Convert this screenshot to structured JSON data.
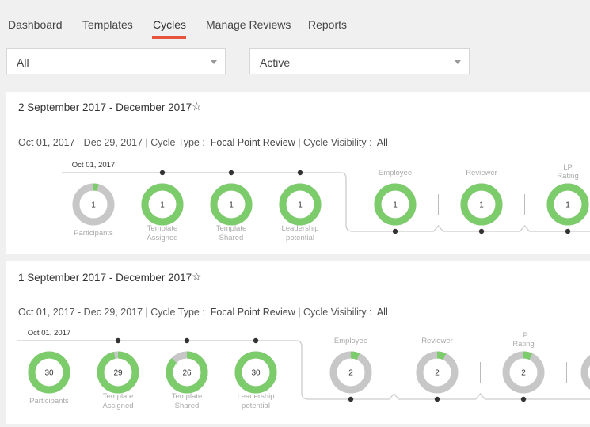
{
  "nav": {
    "tabs": [
      {
        "label": "Dashboard"
      },
      {
        "label": "Templates"
      },
      {
        "label": "Cycles"
      },
      {
        "label": "Manage Reviews"
      },
      {
        "label": "Reports"
      }
    ]
  },
  "filters": {
    "first": "All",
    "second": "Active"
  },
  "colors": {
    "green": "#7ccc6c",
    "grey": "#c7c7c7",
    "accent": "#e8553e"
  },
  "cycles": [
    {
      "title": "2 September 2017 - December 2017",
      "dates": "Oct 01, 2017 - Dec 29, 2017",
      "cycle_type_label": "Cycle Type :",
      "cycle_type": "Focal Point Review",
      "visibility_label": "Cycle Visibility :",
      "visibility": "All",
      "start_label": "Oct 01, 2017",
      "steps": [
        {
          "value": "1",
          "label1": "Participants",
          "label2": "",
          "fraction": 0.04
        },
        {
          "value": "1",
          "label1": "Template",
          "label2": "Assigned",
          "fraction": 1
        },
        {
          "value": "1",
          "label1": "Template",
          "label2": "Shared",
          "fraction": 1
        },
        {
          "value": "1",
          "label1": "Leadership",
          "label2": "potential",
          "fraction": 1
        }
      ],
      "reviews": [
        {
          "value": "1",
          "label1": "Employee",
          "label2": "",
          "fraction": 1
        },
        {
          "value": "1",
          "label1": "Reviewer",
          "label2": "",
          "fraction": 1
        },
        {
          "value": "1",
          "label1": "LP",
          "label2": "Rating",
          "fraction": 1
        }
      ]
    },
    {
      "title": "1 September 2017 - December 2017",
      "dates": "Oct 01, 2017 - Dec 29, 2017",
      "cycle_type_label": "Cycle Type :",
      "cycle_type": "Focal Point Review",
      "visibility_label": "Cycle Visibility :",
      "visibility": "All",
      "start_label": "Oct 01, 2017",
      "steps": [
        {
          "value": "30",
          "label1": "Participants",
          "label2": "",
          "fraction": 1
        },
        {
          "value": "29",
          "label1": "Template",
          "label2": "Assigned",
          "fraction": 0.967
        },
        {
          "value": "26",
          "label1": "Template",
          "label2": "Shared",
          "fraction": 0.867
        },
        {
          "value": "30",
          "label1": "Leadership",
          "label2": "potential",
          "fraction": 1
        }
      ],
      "reviews": [
        {
          "value": "2",
          "label1": "Employee",
          "label2": "",
          "fraction": 0.07
        },
        {
          "value": "2",
          "label1": "Reviewer",
          "label2": "",
          "fraction": 0.07
        },
        {
          "value": "2",
          "label1": "LP",
          "label2": "Rating",
          "fraction": 0.07
        }
      ]
    }
  ]
}
